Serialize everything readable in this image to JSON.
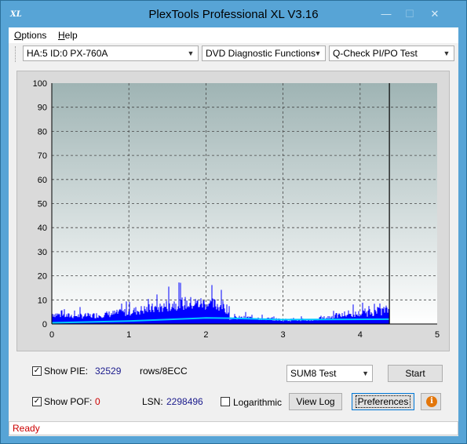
{
  "window": {
    "title": "PlexTools Professional XL V3.16",
    "icon_label": "XL"
  },
  "menu": [
    {
      "label": "Options",
      "underline": "O",
      "rest": "ptions"
    },
    {
      "label": "Help",
      "underline": "H",
      "rest": "elp"
    }
  ],
  "toolbar": {
    "drive": "HA:5 ID:0  PX-760A",
    "function": "DVD Diagnostic Functions",
    "test": "Q-Check PI/PO Test"
  },
  "chart_data": {
    "type": "bar",
    "x_ticks": [
      "0",
      "1",
      "2",
      "3",
      "4",
      "5"
    ],
    "y_ticks": [
      "0",
      "10",
      "20",
      "30",
      "40",
      "50",
      "60",
      "70",
      "80",
      "90",
      "100"
    ],
    "xlim": [
      0,
      5
    ],
    "ylim": [
      0,
      100
    ],
    "grid": true,
    "disc_end_x": 4.38,
    "colors": {
      "pie": "#0000ff",
      "avg": "#00c8ff",
      "bg_top": "#9fb4b4",
      "bg_bottom": "#ffffff"
    },
    "pie_profile": [
      {
        "x": 0.0,
        "y": 5
      },
      {
        "x": 0.2,
        "y": 4
      },
      {
        "x": 0.5,
        "y": 4
      },
      {
        "x": 0.8,
        "y": 5
      },
      {
        "x": 1.0,
        "y": 6
      },
      {
        "x": 1.2,
        "y": 7
      },
      {
        "x": 1.4,
        "y": 8
      },
      {
        "x": 1.6,
        "y": 10
      },
      {
        "x": 1.8,
        "y": 10
      },
      {
        "x": 2.0,
        "y": 10
      },
      {
        "x": 2.2,
        "y": 9
      },
      {
        "x": 2.3,
        "y": 7
      },
      {
        "x": 2.31,
        "y": 3
      },
      {
        "x": 2.6,
        "y": 3
      },
      {
        "x": 3.0,
        "y": 2
      },
      {
        "x": 3.4,
        "y": 2
      },
      {
        "x": 3.7,
        "y": 4
      },
      {
        "x": 4.0,
        "y": 5
      },
      {
        "x": 4.2,
        "y": 6
      },
      {
        "x": 4.38,
        "y": 7
      }
    ],
    "avg_profile": [
      {
        "x": 0.0,
        "y": 0.5
      },
      {
        "x": 1.0,
        "y": 1.2
      },
      {
        "x": 2.0,
        "y": 2.5
      },
      {
        "x": 2.3,
        "y": 2.4
      },
      {
        "x": 3.0,
        "y": 1.8
      },
      {
        "x": 4.38,
        "y": 2.0
      }
    ]
  },
  "controls": {
    "show_pie_label": "Show PIE:",
    "show_pie_checked": true,
    "pie_value": "32529",
    "pie_unit": "rows/8ECC",
    "show_pof_label": "Show POF:",
    "show_pof_checked": true,
    "pof_value": "0",
    "lsn_label": "LSN:",
    "lsn_value": "2298496",
    "logarithmic_label": "Logarithmic",
    "logarithmic_checked": false,
    "test_select": "SUM8 Test",
    "start_button": "Start",
    "view_log_button": "View Log",
    "preferences_button": "Preferences",
    "info_glyph": "i"
  },
  "status": "Ready"
}
